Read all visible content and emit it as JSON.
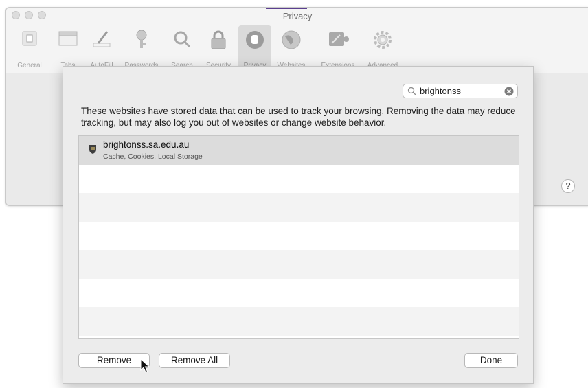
{
  "window": {
    "title": "Privacy",
    "toolbar": [
      {
        "label": "General",
        "icon": "general-icon"
      },
      {
        "label": "Tabs",
        "icon": "tabs-icon"
      },
      {
        "label": "AutoFill",
        "icon": "autofill-icon"
      },
      {
        "label": "Passwords",
        "icon": "key-icon"
      },
      {
        "label": "Search",
        "icon": "search-icon"
      },
      {
        "label": "Security",
        "icon": "lock-icon"
      },
      {
        "label": "Privacy",
        "icon": "hand-icon",
        "selected": true
      },
      {
        "label": "Websites",
        "icon": "globe-icon"
      },
      {
        "label": "Extensions",
        "icon": "puzzle-icon"
      },
      {
        "label": "Advanced",
        "icon": "gear-icon"
      }
    ],
    "help_label": "?"
  },
  "sheet": {
    "search": {
      "value": "brightonss"
    },
    "description": "These websites have stored data that can be used to track your browsing. Removing the data may reduce tracking, but may also log you out of websites or change website behavior.",
    "rows": [
      {
        "title": "brightonss.sa.edu.au",
        "subtitle": "Cache, Cookies, Local Storage",
        "selected": true
      }
    ],
    "buttons": {
      "remove": "Remove",
      "remove_all": "Remove All",
      "done": "Done"
    }
  },
  "colors": {
    "selected_row": "#dcdcdc",
    "title_accent": "#5b3f8f"
  }
}
